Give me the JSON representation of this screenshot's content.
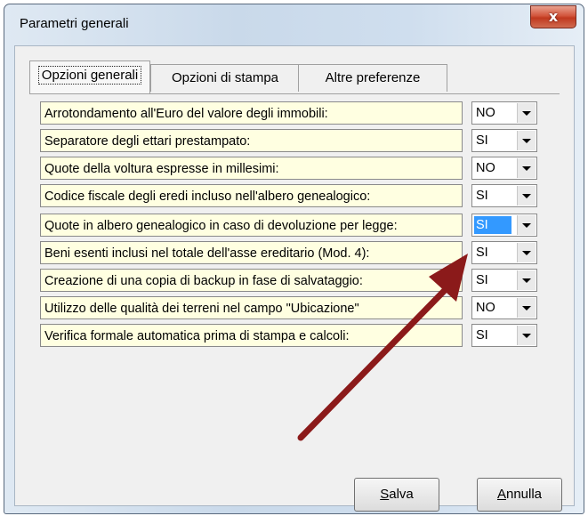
{
  "window": {
    "title": "Parametri generali",
    "close_glyph": "x"
  },
  "tabs": [
    {
      "label": "Opzioni generali",
      "active": true
    },
    {
      "label": "Opzioni di stampa",
      "active": false
    },
    {
      "label": "Altre preferenze",
      "active": false
    }
  ],
  "options": [
    {
      "label": "Arrotondamento all'Euro del valore degli immobili:",
      "value": "NO"
    },
    {
      "label": "Separatore degli ettari prestampato:",
      "value": "SI"
    },
    {
      "label": "Quote della voltura espresse in millesimi:",
      "value": "NO"
    },
    {
      "label": "Codice fiscale degli eredi incluso nell'albero genealogico:",
      "value": "SI"
    },
    {
      "label": "Quote in albero genealogico in caso di devoluzione per legge:",
      "value": "SI",
      "focused": true
    },
    {
      "label": "Beni esenti inclusi nel totale dell'asse ereditario (Mod. 4):",
      "value": "SI"
    },
    {
      "label": "Creazione di una copia di backup in fase di salvataggio:",
      "value": "SI"
    },
    {
      "label": "Utilizzo delle qualità dei terreni nel campo \"Ubicazione\"",
      "value": "NO"
    },
    {
      "label": "Verifica formale automatica prima di stampa e calcoli:",
      "value": "SI"
    }
  ],
  "buttons": {
    "save": {
      "mnemonic": "S",
      "rest": "alva"
    },
    "cancel": {
      "mnemonic": "A",
      "rest": "nnulla"
    }
  },
  "annotation": {
    "icon": "red-arrow-icon",
    "color": "#8b1a1a"
  }
}
